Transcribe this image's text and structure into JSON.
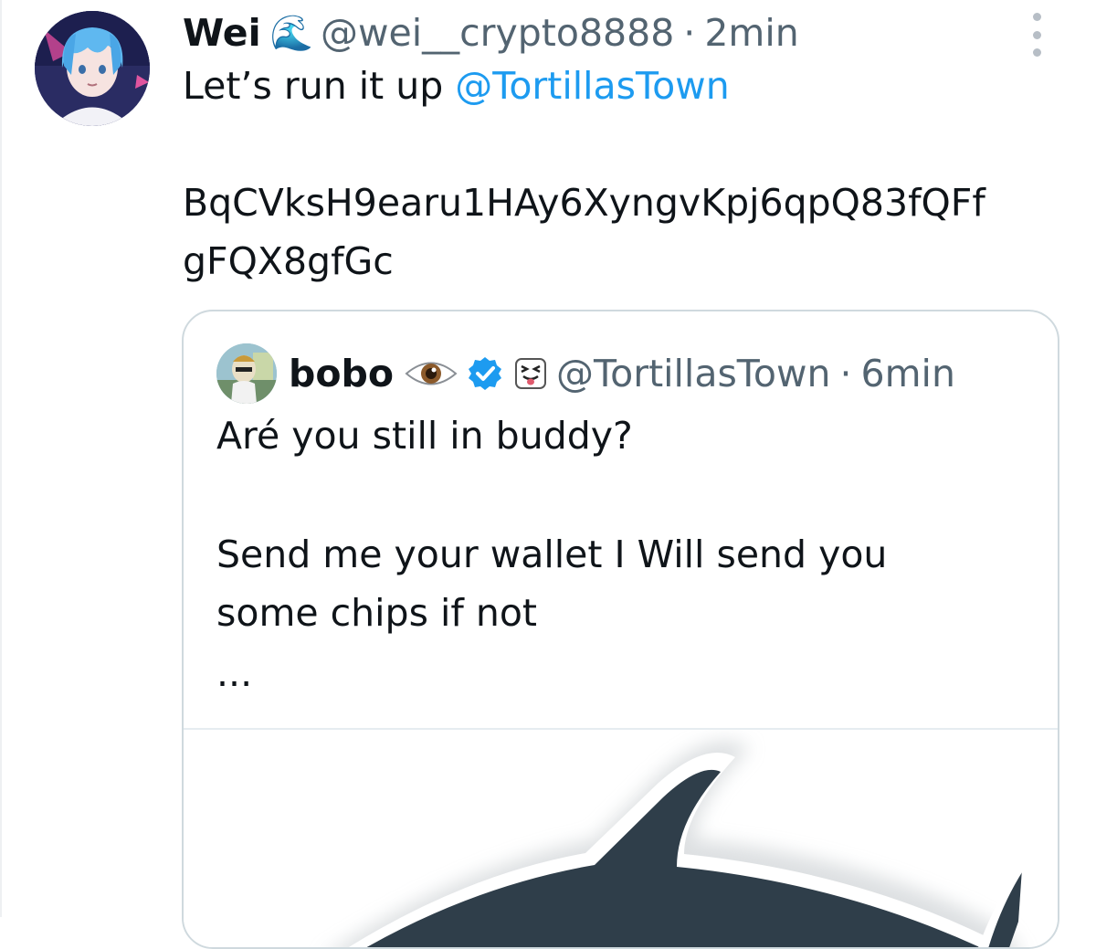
{
  "tweet": {
    "author_name": "Wei",
    "name_emoji": "🌊",
    "handle": "@wei__crypto8888",
    "separator": "·",
    "time": "2min",
    "text_prefix": "Let’s run it up ",
    "mention": "@TortillasTown",
    "address_line1": "BqCVksH9earu1HAy6XyngvKpj6qpQ83fQFf",
    "address_line2": "gFQX8gfGc",
    "icons": [
      "avatar",
      "wave-emoji",
      "more-options-icon"
    ]
  },
  "quote": {
    "author_name": "bobo",
    "handle": "@TortillasTown",
    "separator": "·",
    "time": "6min",
    "line1": "Aré you still in buddy?",
    "line2": "Send me your wallet I Will send you",
    "line3": "some chips if not",
    "ellipsis": "...",
    "icons": [
      "eye-emoji",
      "verified-badge-icon",
      "squint-tongue-emoji",
      "shark-image"
    ]
  },
  "colors": {
    "link": "#1d9bf0",
    "secondary_text": "#536471",
    "primary_text": "#0f1419",
    "border": "#cfd9de",
    "shark": "#2f3e4a"
  }
}
